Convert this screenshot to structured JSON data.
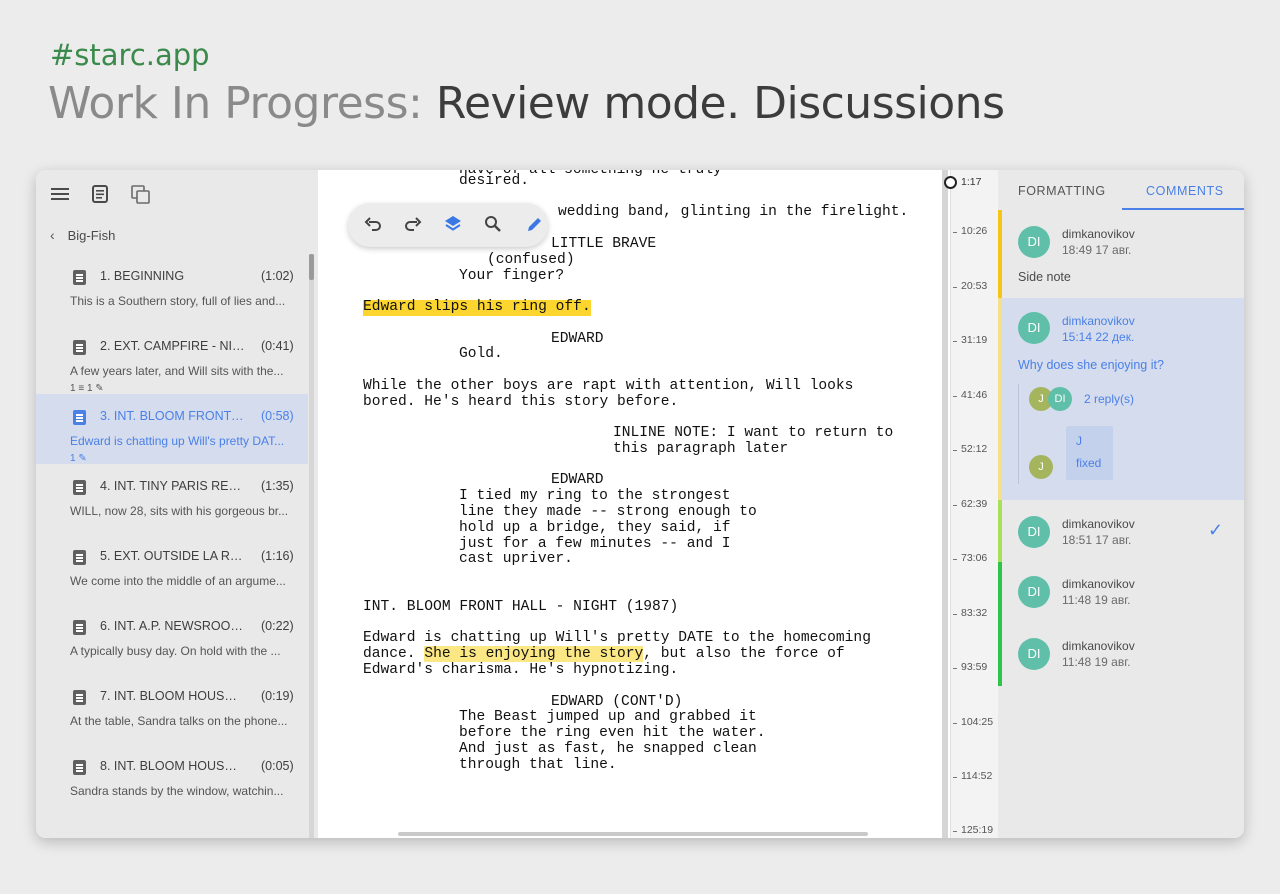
{
  "header": {
    "hashtag": "#starc.app",
    "title_prefix": "Work In Progress:",
    "title_main": "Review mode. Discussions"
  },
  "sidebar": {
    "icons": [
      "menu-icon",
      "document-icon",
      "copy-icon"
    ],
    "breadcrumb": "Big-Fish",
    "scenes": [
      {
        "title": "1. BEGINNING",
        "duration": "(1:02)",
        "desc": "This is a Southern story, full of lies and...",
        "meta": ""
      },
      {
        "title": "2. EXT. CAMPFIRE - NIGH...",
        "duration": "(0:41)",
        "desc": "A few years later, and Will sits with the...",
        "meta": "1 ≡  1 ✎"
      },
      {
        "title": "3. INT. BLOOM FRONT H...",
        "duration": "(0:58)",
        "desc": "Edward is chatting up Will's pretty DAT...",
        "meta": "1 ✎",
        "active": true
      },
      {
        "title": "4. INT. TINY PARIS REST...",
        "duration": "(1:35)",
        "desc": "WILL, now 28, sits with his gorgeous br...",
        "meta": ""
      },
      {
        "title": "5. EXT. OUTSIDE LA RUE ...",
        "duration": "(1:16)",
        "desc": "We come into the middle of an argume...",
        "meta": ""
      },
      {
        "title": "6. INT. A.P. NEWSROOM (...",
        "duration": "(0:22)",
        "desc": "A typically busy day. On hold with the ...",
        "meta": ""
      },
      {
        "title": "7. INT. BLOOM HOUSE KI...",
        "duration": "(0:19)",
        "desc": "At the table, Sandra talks on the phone...",
        "meta": ""
      },
      {
        "title": "8. INT. BLOOM HOUSE M...",
        "duration": "(0:05)",
        "desc": "Sandra stands by the window, watchin...",
        "meta": ""
      }
    ]
  },
  "toolbar": {
    "icons": [
      "undo-icon",
      "redo-icon",
      "layers-icon",
      "search-icon",
      "pen-icon"
    ]
  },
  "script": {
    "l01": "have of all something he truly",
    "l02": "desired.",
    "l03": "wedding band, glinting in the firelight.",
    "l04": "LITTLE BRAVE",
    "l05": "(confused)",
    "l06": "Your finger?",
    "l07": "Edward slips his ring off.",
    "l08": "EDWARD",
    "l09": "Gold.",
    "l10": "While the other boys are rapt with attention, Will looks",
    "l11": "bored. He's heard this story before.",
    "l12": "INLINE NOTE: I want to return to",
    "l13": "this paragraph later",
    "l14": "EDWARD",
    "l15": "I tied my ring to the strongest",
    "l16": "line they made -- strong enough to",
    "l17": "hold up a bridge, they said, if",
    "l18": "just for a few minutes -- and I",
    "l19": "cast upriver.",
    "l20": "INT. BLOOM FRONT HALL - NIGHT (1987)",
    "l21a": "Edward is chatting up Will's pretty DATE to the homecoming",
    "l22a": "dance. ",
    "l22b": "She is enjoying the story",
    "l22c": ", but also the force of",
    "l23": "Edward's charisma. He's hypnotizing.",
    "l24": "EDWARD (CONT'D)",
    "l25": "The Beast jumped up and grabbed it",
    "l26": "before the ring even hit the water.",
    "l27": "And just as fast, he snapped clean",
    "l28": "through that line."
  },
  "timeline": {
    "current": "1:17",
    "ticks": [
      "10:26",
      "20:53",
      "31:19",
      "41:46",
      "52:12",
      "62:39",
      "73:06",
      "83:32",
      "93:59",
      "104:25",
      "114:52",
      "125:19"
    ]
  },
  "panel": {
    "tab_formatting": "FORMATTING",
    "tab_comments": "COMMENTS",
    "comments": [
      {
        "initials": "DI",
        "author": "dimkanovikov",
        "time": "18:49 17 авг.",
        "text": "Side note",
        "color": "#f5c518"
      },
      {
        "initials": "DI",
        "author": "dimkanovikov",
        "time": "15:14 22 дек.",
        "text": "Why does she enjoying it?",
        "color": "#f5e08a",
        "replies": "2 reply(s)",
        "reply_initials_a": "J",
        "reply_initials_b": "DI",
        "reply_name": "J",
        "reply_text": "fixed"
      },
      {
        "initials": "DI",
        "author": "dimkanovikov",
        "time": "18:51 17 авг.",
        "color": "#a9e05a",
        "resolved_icon": "check-icon"
      },
      {
        "initials": "DI",
        "author": "dimkanovikov",
        "time": "11:48 19 авг.",
        "color": "#2ec44a"
      },
      {
        "initials": "DI",
        "author": "dimkanovikov",
        "time": "11:48 19 авг.",
        "color": "#2ec44a"
      }
    ]
  }
}
